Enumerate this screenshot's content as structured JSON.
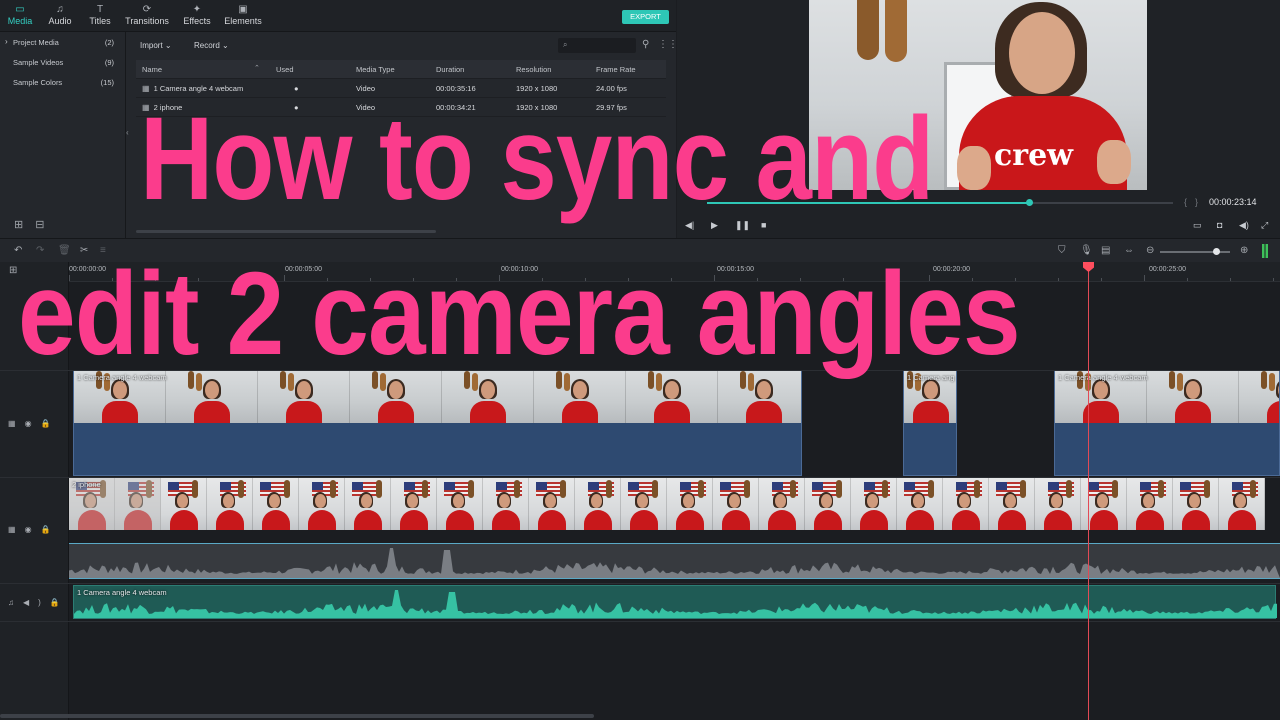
{
  "media_tabs": [
    {
      "label": "Media",
      "icon": "folder-icon",
      "glyph": "▭"
    },
    {
      "label": "Audio",
      "icon": "music-note-icon",
      "glyph": "♫"
    },
    {
      "label": "Titles",
      "icon": "text-icon",
      "glyph": "T"
    },
    {
      "label": "Transitions",
      "icon": "transition-icon",
      "glyph": "⟳"
    },
    {
      "label": "Effects",
      "icon": "sparkle-icon",
      "glyph": "✦"
    },
    {
      "label": "Elements",
      "icon": "image-icon",
      "glyph": "▣"
    }
  ],
  "export_label": "EXPORT",
  "sidebar": {
    "items": [
      {
        "label": "Project Media",
        "count": "(2)"
      },
      {
        "label": "Sample Videos",
        "count": "(9)"
      },
      {
        "label": "Sample Colors",
        "count": "(15)"
      }
    ]
  },
  "toolbar": {
    "import_label": "Import",
    "record_label": "Record",
    "search_placeholder": ""
  },
  "media_table": {
    "columns": [
      "Name",
      "Used",
      "Media Type",
      "Duration",
      "Resolution",
      "Frame Rate"
    ],
    "rows": [
      {
        "name": "1 Camera angle 4 webcam",
        "used": "●",
        "type": "Video",
        "duration": "00:00:35:16",
        "resolution": "1920 x 1080",
        "fps": "24.00 fps"
      },
      {
        "name": "2 iphone",
        "used": "●",
        "type": "Video",
        "duration": "00:00:34:21",
        "resolution": "1920 x 1080",
        "fps": "29.97 fps"
      }
    ]
  },
  "preview": {
    "time": "00:00:23:14",
    "progress": 0.69,
    "shirt_text": "crew",
    "bracket_left": "{",
    "bracket_right": "}"
  },
  "ruler_labels": [
    "00:00:00:00",
    "00:00:05:00",
    "00:00:10:00",
    "00:00:15:00",
    "00:00:20:00",
    "00:00:25:00"
  ],
  "zoom_level": 0.8,
  "tracks": {
    "video1_clips": [
      {
        "label": "1 Camera angle 4 webcam"
      },
      {
        "label": "1 Camera ang"
      },
      {
        "label": "1 Camera angle 4 webcam"
      }
    ],
    "video2_label": "2 iphone",
    "audio1_label": "1 Camera angle 4 webcam"
  },
  "overlay": {
    "line1": "How to sync and",
    "line2": "edit 2 camera angles",
    "color": "#fb3c8c"
  },
  "colors": {
    "accent": "#2ec7b6",
    "playhead": "#ff4e5e",
    "clip_blue": "#2e4a71",
    "audio_green": "#1f5b55"
  }
}
